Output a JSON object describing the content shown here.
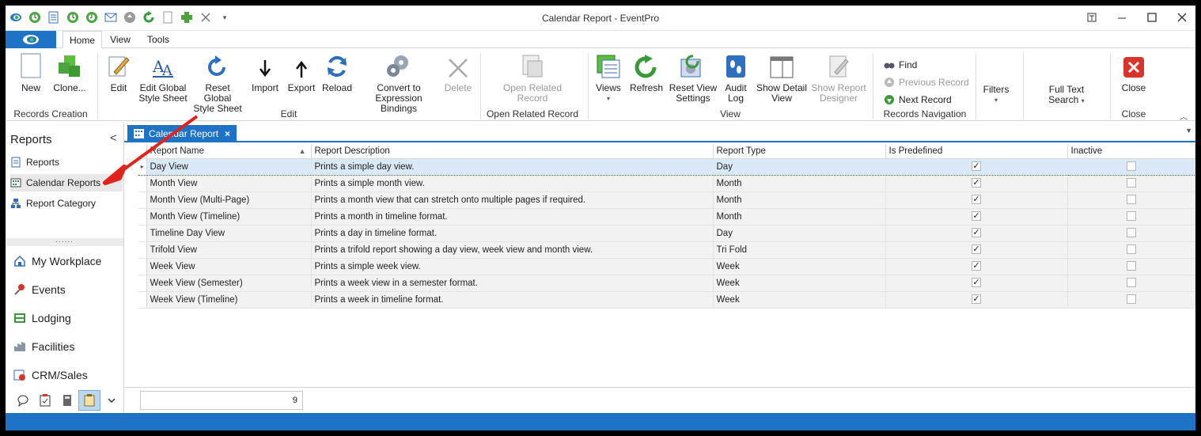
{
  "window": {
    "title": "Calendar Report - EventPro"
  },
  "quick_access": [
    "app-logo-icon",
    "back-icon",
    "document-icon",
    "back-icon",
    "back-icon",
    "mail-icon",
    "circle-up-icon",
    "refresh-icon",
    "page-icon",
    "add-icon",
    "close-icon",
    "dropdown-icon"
  ],
  "ribbon_tabs": [
    "Home",
    "View",
    "Tools"
  ],
  "ribbon": {
    "records_creation": {
      "label": "Records Creation",
      "new": "New",
      "clone": "Clone..."
    },
    "edit": {
      "label": "Edit",
      "edit": "Edit",
      "edit_global_1": "Edit Global",
      "edit_global_2": "Style Sheet",
      "reset_global_1": "Reset Global",
      "reset_global_2": "Style Sheet",
      "import": "Import",
      "export": "Export",
      "reload": "Reload",
      "convert_1": "Convert to",
      "convert_2": "Expression Bindings",
      "delete": "Delete"
    },
    "open_related": {
      "label": "Open Related Record",
      "btn_1": "Open Related",
      "btn_2": "Record"
    },
    "view": {
      "label": "View",
      "views": "Views",
      "refresh": "Refresh",
      "reset_view_1": "Reset View",
      "reset_view_2": "Settings",
      "audit_1": "Audit",
      "audit_2": "Log",
      "show_detail_1": "Show Detail",
      "show_detail_2": "View",
      "show_report_1": "Show Report",
      "show_report_2": "Designer"
    },
    "records_nav": {
      "label": "Records Navigation",
      "find": "Find",
      "previous": "Previous Record",
      "next": "Next Record"
    },
    "filters": "Filters",
    "fulltext_1": "Full Text",
    "fulltext_2": "Search",
    "close": {
      "label": "Close",
      "btn": "Close"
    }
  },
  "nav": {
    "header": "Reports",
    "collapse": "<",
    "items": [
      {
        "label": "Reports",
        "icon": "reports-icon"
      },
      {
        "label": "Calendar Reports",
        "icon": "calendar-grid-icon"
      },
      {
        "label": "Report Category",
        "icon": "category-tree-icon"
      }
    ],
    "splitter": "......",
    "modules": [
      {
        "label": "My Workplace",
        "icon": "house-icon"
      },
      {
        "label": "Events",
        "icon": "pin-icon"
      },
      {
        "label": "Lodging",
        "icon": "building-icon"
      },
      {
        "label": "Facilities",
        "icon": "facilities-icon"
      },
      {
        "label": "CRM/Sales",
        "icon": "crm-icon"
      }
    ],
    "bottom_icons": [
      "chat-icon",
      "clipboard-check-icon",
      "calculator-icon",
      "clipboard-icon",
      "chevron-down-icon"
    ]
  },
  "doc_tab": {
    "label": "Calendar Report",
    "close": "×",
    "menu": "▼"
  },
  "grid": {
    "columns": [
      "Report Name",
      "Report Description",
      "Report Type",
      "Is Predefined",
      "Inactive"
    ],
    "rows": [
      {
        "name": "Day View",
        "description": "Prints a simple day view.",
        "type": "Day",
        "predefined": true,
        "inactive": false
      },
      {
        "name": "Month View",
        "description": "Prints a simple month view.",
        "type": "Month",
        "predefined": true,
        "inactive": false
      },
      {
        "name": "Month View (Multi-Page)",
        "description": "Prints a month view that can stretch onto multiple pages if required.",
        "type": "Month",
        "predefined": true,
        "inactive": false
      },
      {
        "name": "Month View (Timeline)",
        "description": "Prints a month in timeline format.",
        "type": "Month",
        "predefined": true,
        "inactive": false
      },
      {
        "name": "Timeline Day View",
        "description": "Prints a day in timeline format.",
        "type": "Day",
        "predefined": true,
        "inactive": false
      },
      {
        "name": "Trifold View",
        "description": "Prints a trifold report showing a day view, week view and month view.",
        "type": "Tri Fold",
        "predefined": true,
        "inactive": false
      },
      {
        "name": "Week View",
        "description": "Prints a simple week view.",
        "type": "Week",
        "predefined": true,
        "inactive": false
      },
      {
        "name": "Week View (Semester)",
        "description": "Prints a week view in a semester format.",
        "type": "Week",
        "predefined": true,
        "inactive": false
      },
      {
        "name": "Week View (Timeline)",
        "description": "Prints a week in timeline format.",
        "type": "Week",
        "predefined": true,
        "inactive": false
      }
    ]
  },
  "footer": {
    "count": "9"
  },
  "colors": {
    "accent": "#1e73c7",
    "selected_row": "#dbe8f6",
    "annotation_arrow": "#e0231b"
  }
}
